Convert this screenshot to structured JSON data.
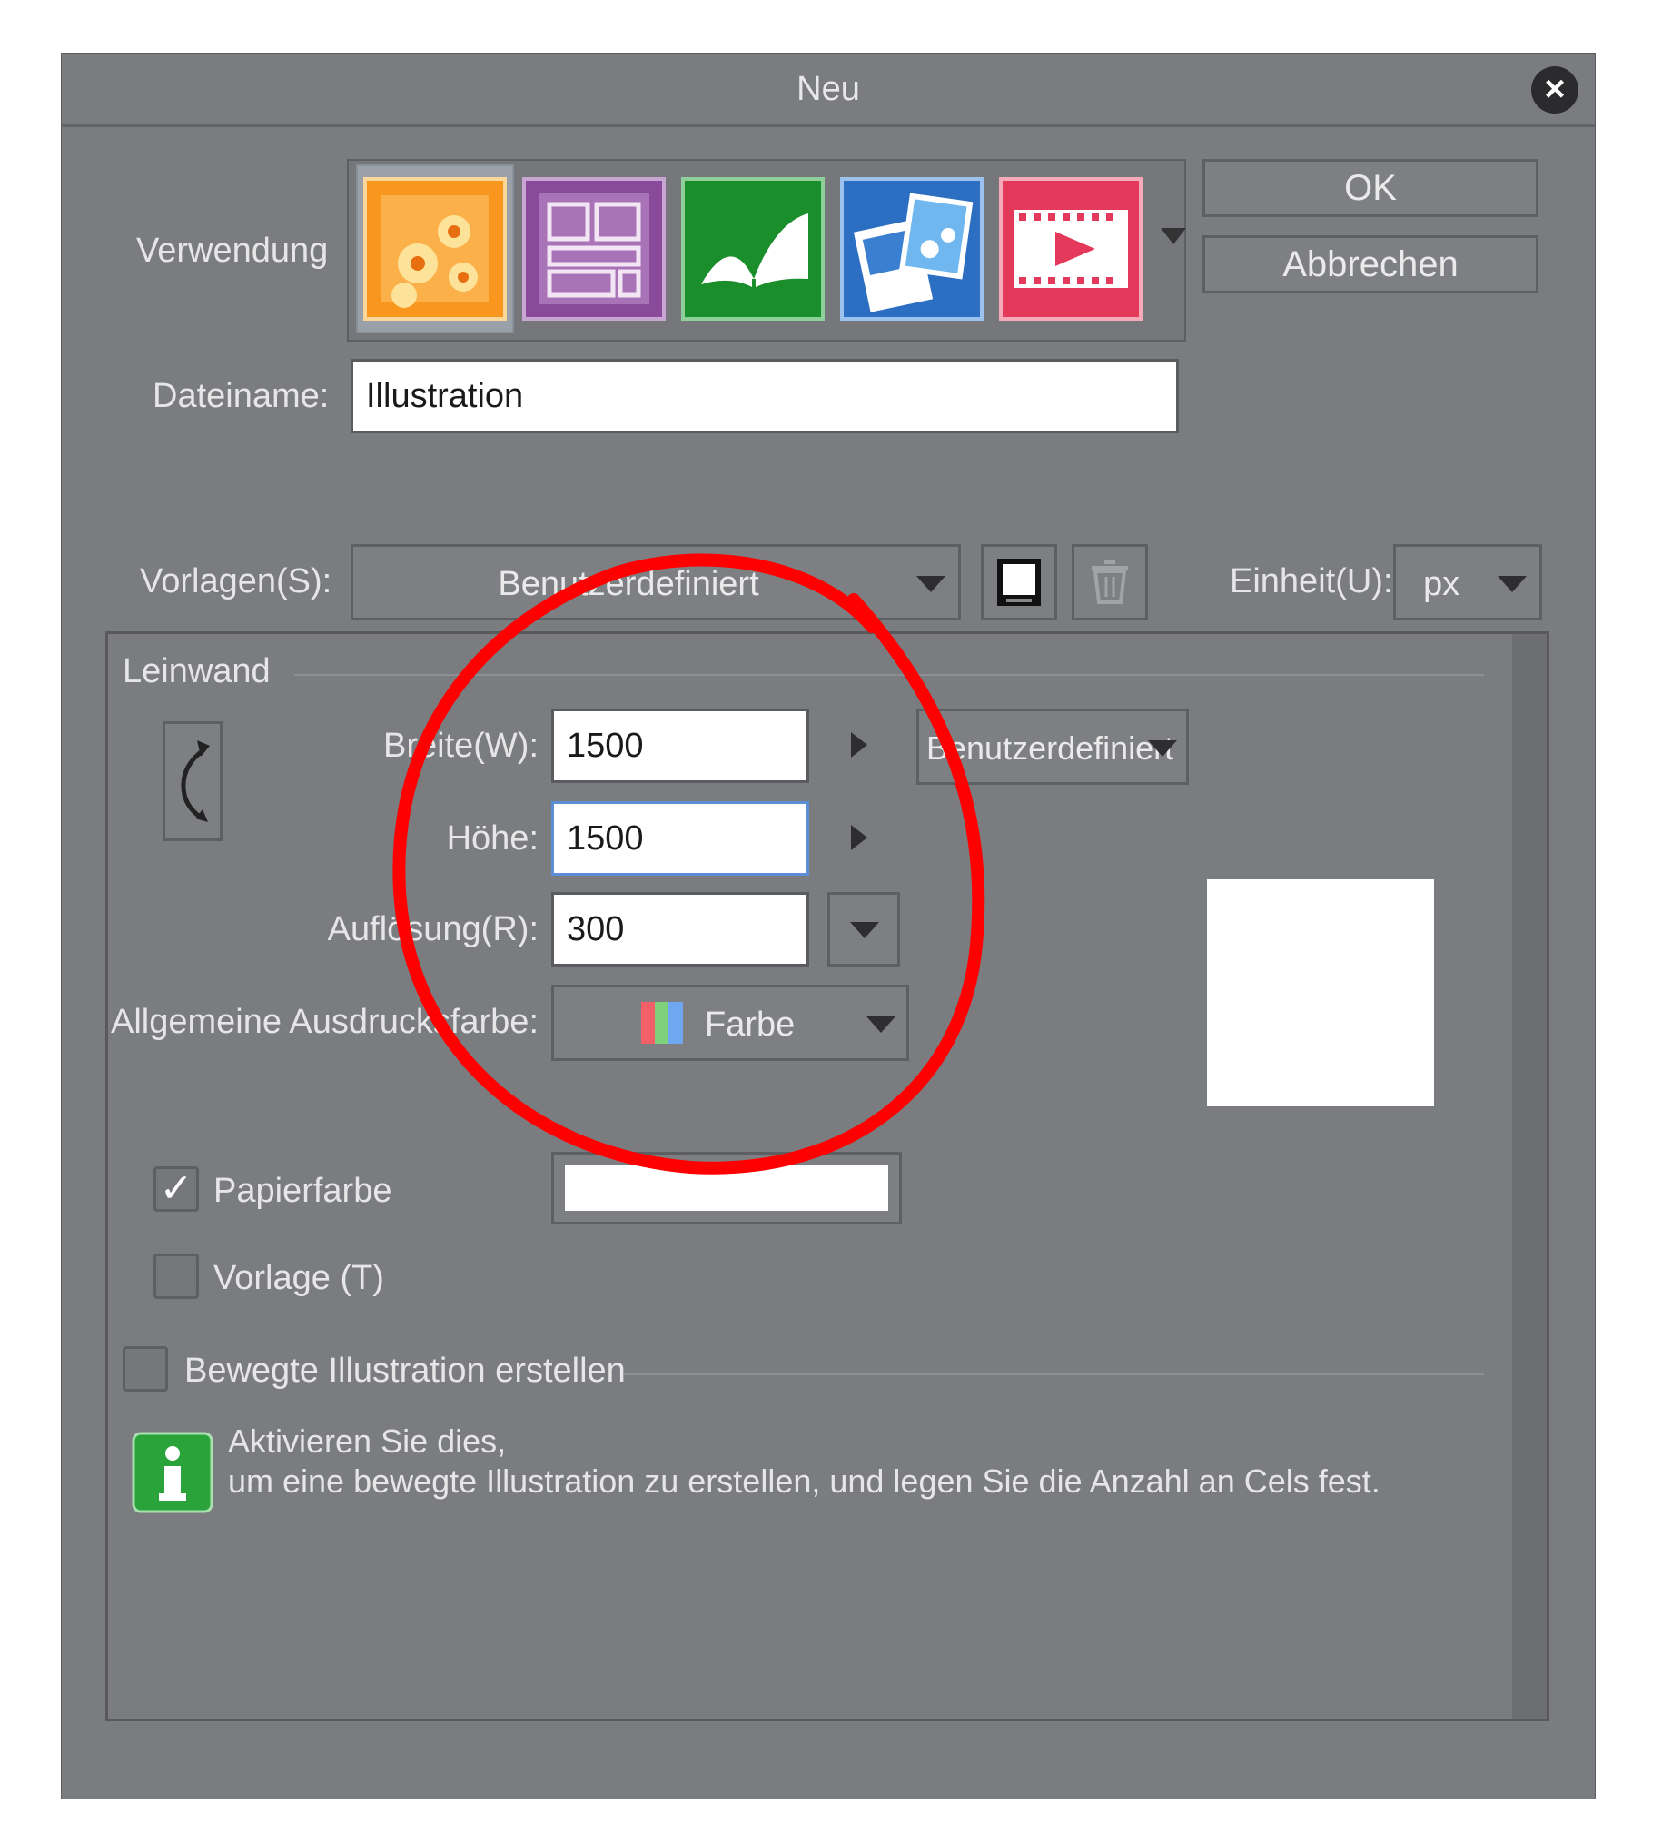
{
  "dialog": {
    "title": "Neu",
    "close_icon": "close-icon",
    "ok_label": "OK",
    "cancel_label": "Abbrechen"
  },
  "usage": {
    "label": "Verwendung",
    "items": [
      {
        "name": "illustration",
        "icon": "flower-illustration-icon",
        "color": "#f5901e"
      },
      {
        "name": "comic",
        "icon": "comic-panels-icon",
        "color": "#8a4d9e"
      },
      {
        "name": "book",
        "icon": "open-book-icon",
        "color": "#1e8f2c"
      },
      {
        "name": "print",
        "icon": "photo-print-icon",
        "color": "#2f6fc0"
      },
      {
        "name": "animation",
        "icon": "film-play-icon",
        "color": "#e23a5a"
      }
    ]
  },
  "filename": {
    "label": "Dateiname:",
    "value": "Illustration"
  },
  "templates": {
    "label": "Vorlagen(S):",
    "value": "Benutzerdefiniert",
    "unit_label": "Einheit(U):",
    "unit_value": "px"
  },
  "canvas": {
    "section_label": "Leinwand",
    "width_label": "Breite(W):",
    "width_value": "1500",
    "height_label": "Höhe:",
    "height_value": "1500",
    "resolution_label": "Auflösung(R):",
    "resolution_value": "300",
    "preset_value": "Benutzerdefiniert",
    "color_label": "Allgemeine Ausdrucksfarbe:",
    "color_value": "Farbe"
  },
  "paper": {
    "paper_color_label": "Papierfarbe",
    "paper_color_checked": true,
    "template_label": "Vorlage (T)",
    "template_checked": false
  },
  "animation": {
    "label": "Bewegte Illustration erstellen",
    "info_line1": "Aktivieren Sie dies,",
    "info_line2": "um eine bewegte Illustration zu erstellen, und legen Sie die Anzahl an Cels fest."
  },
  "colors": {
    "annotation": "#ff0000"
  }
}
